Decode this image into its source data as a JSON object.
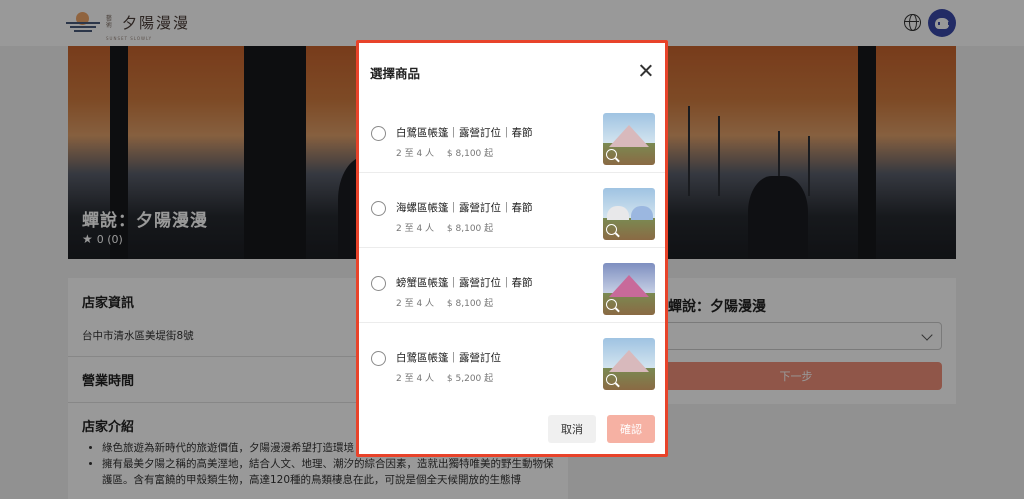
{
  "header": {
    "logo_small": "藝術",
    "logo_text": "夕陽漫漫",
    "logo_sub": "SUNSET SLOWLY"
  },
  "hero": {
    "title": "蟬說：夕陽漫漫",
    "rating_text": "0 (0)"
  },
  "store_info": {
    "section_title": "店家資訊",
    "address": "台中市清水區美堤街8號",
    "hours_title": "營業時間",
    "intro_title": "店家介紹",
    "intro_bullets": [
      "綠色旅遊為新時代的旅遊價值，夕陽漫漫希望打造環境",
      "擁有最美夕陽之稱的高美溼地，結合人文、地理、潮汐的綜合因素，造就出獨特唯美的野生動物保護區。含有富饒的甲殼類生物，高達120種的鳥類棲息在此，可說是個全天候開放的生態博"
    ]
  },
  "booking": {
    "shop_name": "蟬說：夕陽漫漫",
    "next_label": "下一步"
  },
  "modal": {
    "title": "選擇商品",
    "items": [
      {
        "name": "白鷺區帳篷｜露營訂位｜春節",
        "people": "2 至 4 人",
        "price": "$ 8,100 起"
      },
      {
        "name": "海螺區帳篷｜露營訂位｜春節",
        "people": "2 至 4 人",
        "price": "$ 8,100 起"
      },
      {
        "name": "螃蟹區帳篷｜露營訂位｜春節",
        "people": "2 至 4 人",
        "price": "$ 8,100 起"
      },
      {
        "name": "白鷺區帳篷｜露營訂位",
        "people": "2 至 4 人",
        "price": "$ 5,200 起"
      }
    ],
    "cancel_label": "取消",
    "confirm_label": "確認"
  },
  "colors": {
    "accent": "#e8432a",
    "confirm_disabled": "#f6b1a3",
    "next_button": "#f1907a",
    "avatar": "#3948a8"
  },
  "icons": [
    "globe-icon",
    "avatar",
    "star-icon",
    "close-icon",
    "radio-icon",
    "zoom-icon",
    "chevron-down-icon"
  ]
}
